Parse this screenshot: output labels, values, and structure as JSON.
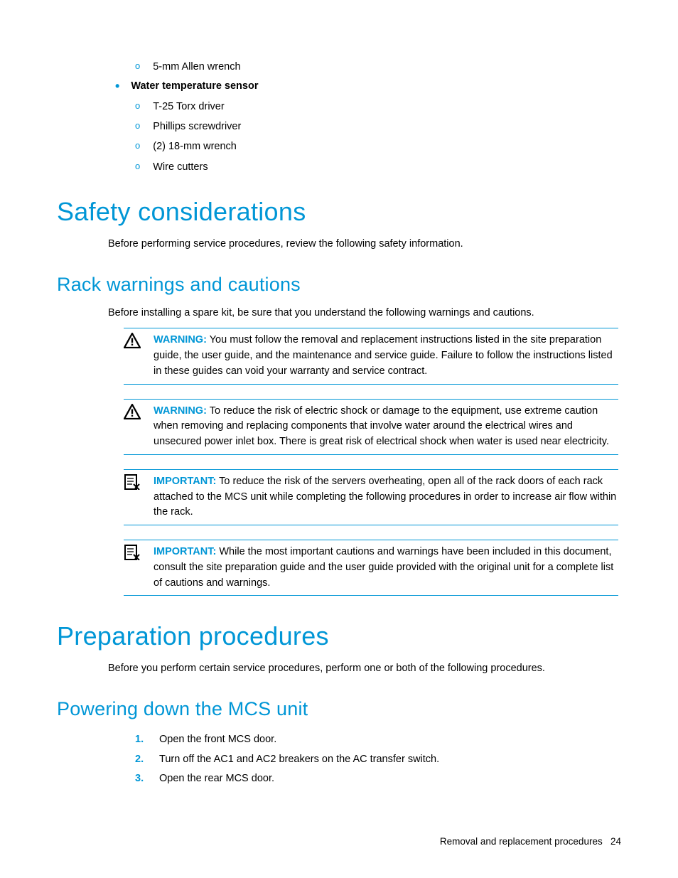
{
  "tools_list": {
    "pre_item": "5-mm Allen wrench",
    "header": "Water temperature sensor",
    "items": [
      "T-25 Torx driver",
      "Phillips screwdriver",
      "(2) 18-mm wrench",
      "Wire cutters"
    ]
  },
  "section1": {
    "title": "Safety considerations",
    "intro": "Before performing service procedures, review the following safety information.",
    "subsection": {
      "title": "Rack warnings and cautions",
      "intro": "Before installing a spare kit, be sure that you understand the following warnings and cautions.",
      "callouts": [
        {
          "type": "warning",
          "label": "WARNING:",
          "text": "You must follow the removal and replacement instructions listed in the site preparation guide, the user guide, and the maintenance and service guide. Failure to follow the instructions listed in these guides can void your warranty and service contract."
        },
        {
          "type": "warning",
          "label": "WARNING:",
          "text": "To reduce the risk of electric shock or damage to the equipment, use extreme caution when removing and replacing components that involve water around the electrical wires and unsecured power inlet box. There is great risk of electrical shock when water is used near electricity."
        },
        {
          "type": "important",
          "label": "IMPORTANT:",
          "text": "To reduce the risk of the servers overheating, open all of the rack doors of each rack attached to the MCS unit while completing the following procedures in order to increase air flow within the rack."
        },
        {
          "type": "important",
          "label": "IMPORTANT:",
          "text": "While the most important cautions and warnings have been included in this document, consult the site preparation guide and the user guide provided with the original unit for a complete list of cautions and warnings."
        }
      ]
    }
  },
  "section2": {
    "title": "Preparation procedures",
    "intro": "Before you perform certain service procedures, perform one or both of the following procedures.",
    "subsection": {
      "title": "Powering down the MCS unit",
      "steps": [
        "Open the front MCS door.",
        "Turn off the AC1 and AC2 breakers on the AC transfer switch.",
        "Open the rear MCS door."
      ]
    }
  },
  "footer": {
    "text": "Removal and replacement procedures",
    "page": "24"
  }
}
